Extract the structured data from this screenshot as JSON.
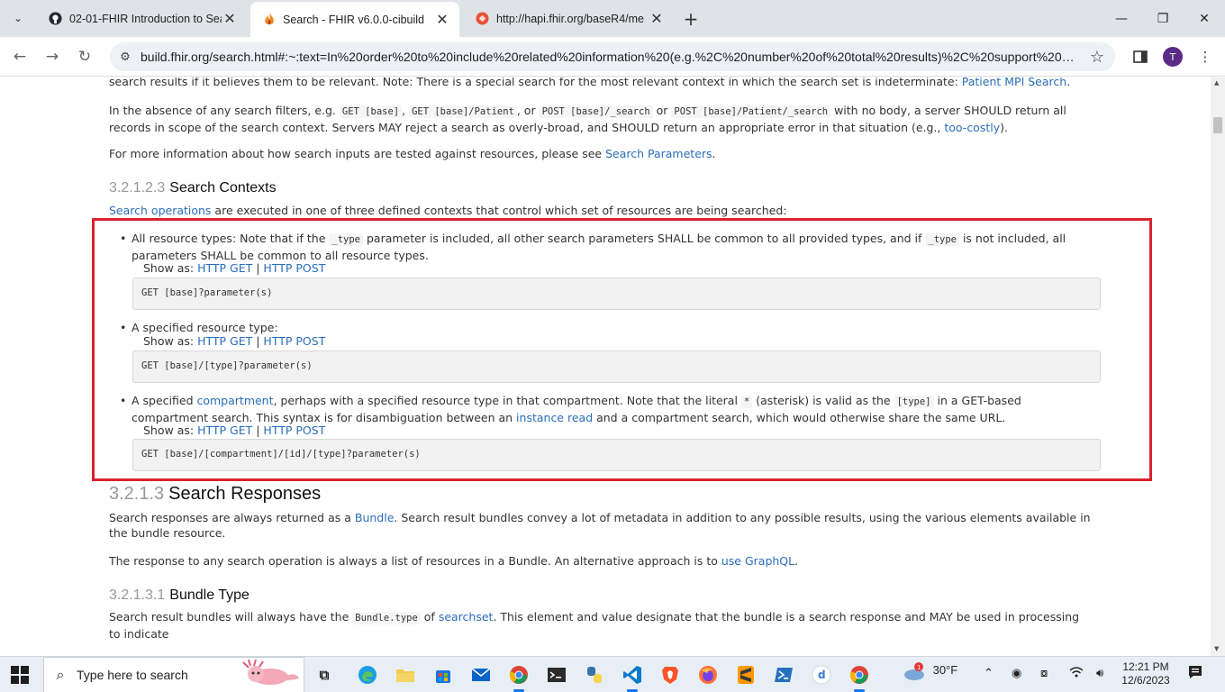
{
  "browser": {
    "tabs": [
      {
        "title": "02-01-FHIR Introduction to Sea",
        "icon": "github-icon"
      },
      {
        "title": "Search - FHIR v6.0.0-cibuild",
        "icon": "fhir-flame-icon"
      },
      {
        "title": "http://hapi.fhir.org/baseR4/me",
        "icon": "hapi-icon"
      }
    ],
    "url": "build.fhir.org/search.html#:~:text=In%20order%20to%20include%20related%20information%20(e.g.%2C%20number%20of%20total%20results)%2C%20support%20ext…",
    "profile_initial": "T"
  },
  "page": {
    "top_para": {
      "text": "search results if it believes them to be relevant. Note: There is a special search for the most relevant context in which the search set is indeterminate: ",
      "link": "Patient MPI Search",
      "end": "."
    },
    "absence_para": {
      "t1": "In the absence of any search filters, e.g. ",
      "c1": "GET [base]",
      "t2": ", ",
      "c2": "GET [base]/Patient",
      "t3": ", or ",
      "c3": "POST [base]/_search",
      "t4": " or ",
      "c4": "POST [base]/Patient/_search",
      "t5": " with no body, a server SHOULD return all records in scope of the search context. Servers MAY reject a search as overly-broad, and SHOULD return an appropriate error in that situation (e.g., ",
      "link": "too-costly",
      "end": ")."
    },
    "info_para": {
      "text": "For more information about how search inputs are tested against resources, please see ",
      "link": "Search Parameters",
      "end": "."
    },
    "contexts_heading": {
      "num": "3.2.1.2.3",
      "title": "Search Contexts"
    },
    "contexts_intro": {
      "link": "Search operations",
      "text": " are executed in one of three defined contexts that control which set of resources are being searched:"
    },
    "show_as_label": "Show as: ",
    "http_get": "HTTP GET",
    "http_post": "HTTP POST",
    "separator": " | ",
    "bullet1": {
      "t1": "All resource types: Note that if the ",
      "c1": "_type",
      "t2": " parameter is included, all other search parameters SHALL be common to all provided types, and if ",
      "c2": "_type",
      "t3": " is not included, all parameters SHALL be common to all resource types.",
      "code": "GET [base]?parameter(s)"
    },
    "bullet2": {
      "text": "A specified resource type:",
      "code": "GET [base]/[type]?parameter(s)"
    },
    "bullet3": {
      "t1": "A specified ",
      "link1": "compartment",
      "t2": ", perhaps with a specified resource type in that compartment. Note that the literal ",
      "c1": "*",
      "t3": " (asterisk) is valid as the ",
      "c2": "[type]",
      "t4": " in a GET-based compartment search. This syntax is for disambiguation between an ",
      "link2": "instance read",
      "t5": " and a compartment search, which would otherwise share the same URL.",
      "code": "GET [base]/[compartment]/[id]/[type]?parameter(s)"
    },
    "responses_heading": {
      "num": "3.2.1.3",
      "title": "Search Responses"
    },
    "responses_para": {
      "t1": "Search responses are always returned as a ",
      "link": "Bundle",
      "t2": ". Search result bundles convey a lot of metadata in addition to any possible results, using the various elements available in the bundle resource."
    },
    "response_para2": {
      "text": "The response to any search operation is always a list of resources in a Bundle. An alternative approach is to ",
      "link": "use GraphQL",
      "end": "."
    },
    "bundle_heading": {
      "num": "3.2.1.3.1",
      "title": "Bundle Type"
    },
    "bundle_para": {
      "t1": "Search result bundles will always have the ",
      "c1": "Bundle.type",
      "t2": " of ",
      "link": "searchset",
      "t3": ". This element and value designate that the bundle is a search response and MAY be used in processing to indicate"
    }
  },
  "taskbar": {
    "search_placeholder": "Type here to search",
    "weather": "30°F",
    "weather_badge": "1",
    "time": "12:21 PM",
    "date": "12/6/2023"
  }
}
